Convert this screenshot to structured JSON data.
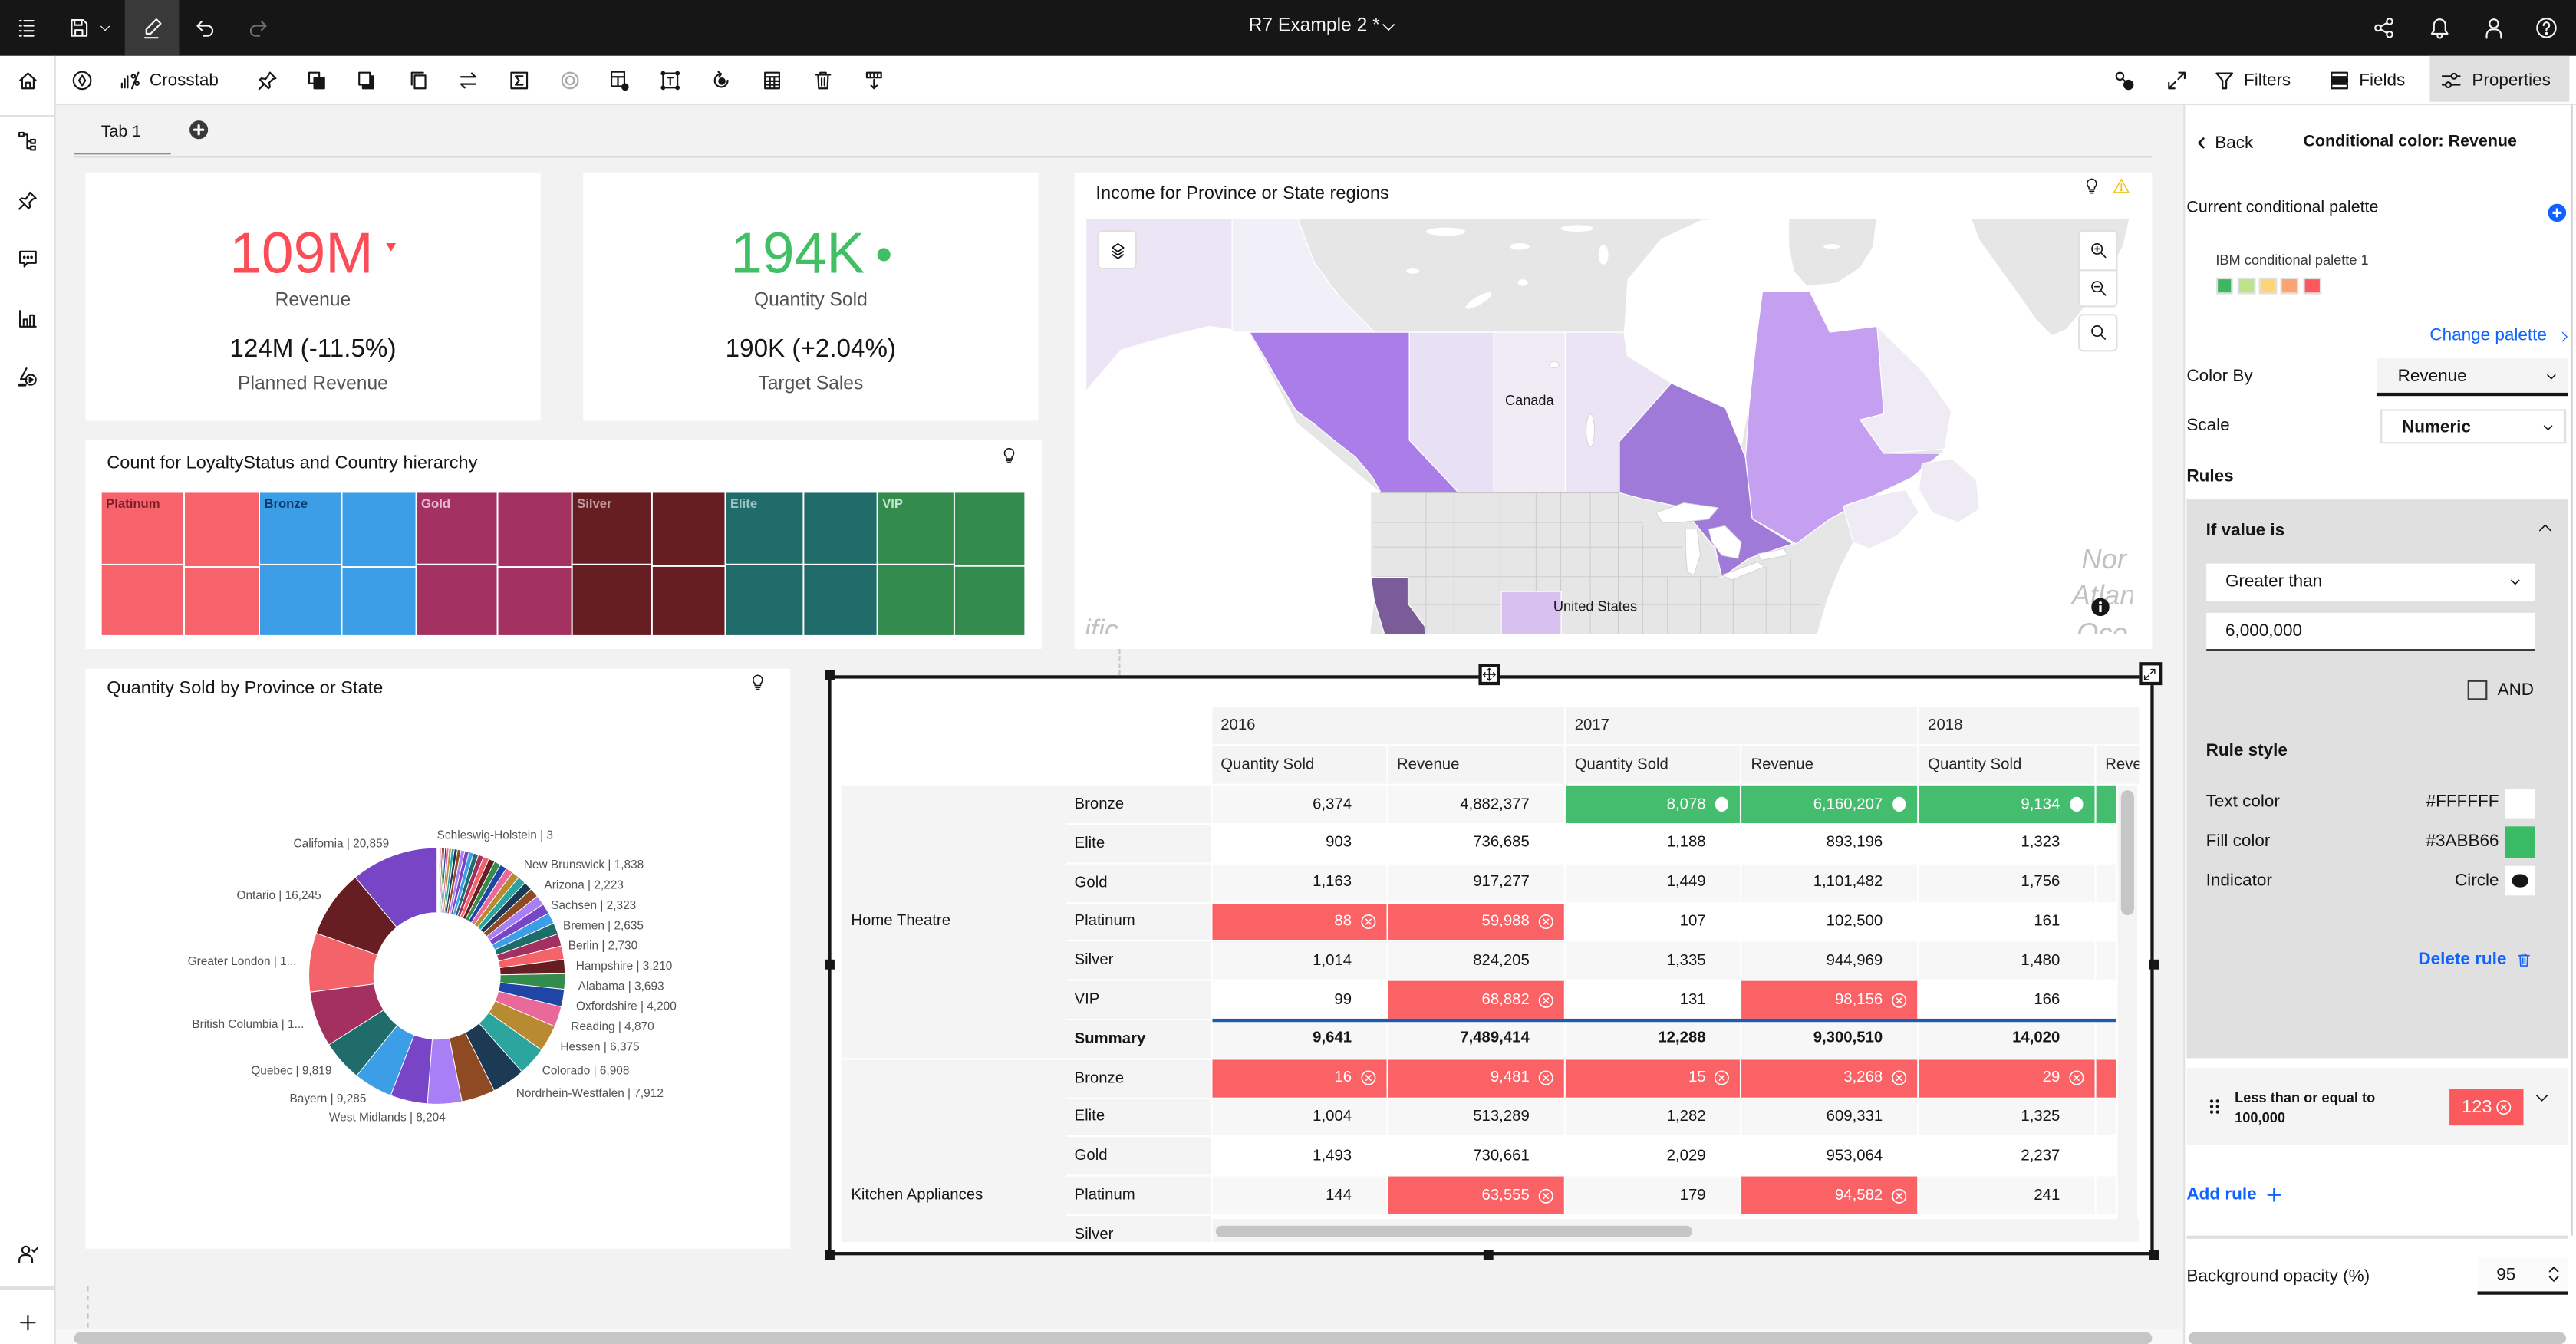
{
  "topbar": {
    "title": "R7 Example 2 *",
    "left_icons": [
      "menu-icon",
      "save-icon",
      "chevron-down-icon",
      "edit-icon",
      "undo-icon",
      "redo-icon"
    ],
    "right_icons": [
      "share-icon",
      "notification-icon",
      "user-icon",
      "help-icon"
    ]
  },
  "sidebar": {
    "items": [
      "home-icon",
      "data-tree-icon",
      "pin-icon",
      "chat-icon",
      "bar-chart-icon",
      "shapes-media-icon"
    ],
    "bottom_items": [
      "user-check-icon",
      "add-icon"
    ]
  },
  "toolbar": {
    "widget_type_label": "Crosstab",
    "icons": [
      "navigate-icon",
      "crosstab-icon",
      "pin-icon",
      "duplicate-icon",
      "bring-forward-icon",
      "send-backward-icon",
      "swap-icon",
      "summarize-icon",
      "format-icon",
      "table-settings-icon",
      "text-frame-icon",
      "refresh-icon",
      "table-icon",
      "delete-icon",
      "insert-column-icon"
    ],
    "right_icons": [
      "focus-icon",
      "expand-icon"
    ],
    "filters_label": "Filters",
    "fields_label": "Fields",
    "properties_label": "Properties",
    "active_panel": "Properties"
  },
  "tabs": [
    {
      "label": "Tab 1",
      "active": true
    }
  ],
  "kpis": [
    {
      "value": "109M",
      "label": "Revenue",
      "comparison": "124M (-11.5%)",
      "comparison_label": "Planned Revenue",
      "indicator": "down-triangle",
      "color": "#fa4d56"
    },
    {
      "value": "194K",
      "label": "Quantity Sold",
      "comparison": "190K (+2.04%)",
      "comparison_label": "Target Sales",
      "indicator": "circle",
      "color": "#42be65"
    }
  ],
  "map": {
    "title": "Income for Province or State regions",
    "country_labels": [
      "Canada",
      "United States"
    ],
    "ocean_label_fragments": [
      "Nor",
      "Atlan",
      "Oce",
      "ific"
    ],
    "water_color": "#ffffff",
    "land_color": "#e6e6e6",
    "fills": {
      "alaska": "#ebe5f6",
      "yukon": "#f1eff7",
      "british_columbia": "#ab7de8",
      "alberta": "#e8e0f5",
      "saskatchewan": "#efecf6",
      "manitoba": "#ebe4f5",
      "ontario": "#a07ad8",
      "quebec": "#c59ff0",
      "newfoundland_labrador": "#eeebf5",
      "maritimes": "#eeebf5",
      "california": "#7a5c98",
      "colorado": "#d9c1ef"
    }
  },
  "chart_data": [
    {
      "type": "pie",
      "variant": "donut",
      "title": "Quantity Sold by Province or State",
      "measure": "Quantity Sold",
      "order": "ascending, clockwise from top",
      "slices": [
        {
          "label": "Schleswig-Holstein",
          "value": 3,
          "text": "Schleswig-Holstein | 3",
          "color": "#b88b33"
        },
        {
          "value": 10,
          "color": "#2ba59e"
        },
        {
          "value": 25,
          "color": "#1c3a56"
        },
        {
          "value": 45,
          "color": "#8e4a22"
        },
        {
          "value": 70,
          "color": "#a87ff5"
        },
        {
          "value": 100,
          "color": "#7845c6"
        },
        {
          "value": 140,
          "color": "#3b9ee6"
        },
        {
          "value": 180,
          "color": "#1f6c6a"
        },
        {
          "value": 230,
          "color": "#a3305f"
        },
        {
          "value": 280,
          "color": "#f4626a"
        },
        {
          "value": 340,
          "color": "#661e22"
        },
        {
          "value": 400,
          "color": "#348b4e"
        },
        {
          "value": 460,
          "color": "#1f46a6"
        },
        {
          "value": 530,
          "color": "#e8699a"
        },
        {
          "value": 600,
          "color": "#b88b33"
        },
        {
          "value": 680,
          "color": "#2ba59e"
        },
        {
          "value": 760,
          "color": "#1c3a56"
        },
        {
          "value": 840,
          "color": "#8e4a22"
        },
        {
          "value": 930,
          "color": "#a87ff5"
        },
        {
          "value": 1020,
          "color": "#7845c6"
        },
        {
          "value": 1110,
          "color": "#3b9ee6"
        },
        {
          "value": 1200,
          "color": "#1f6c6a"
        },
        {
          "value": 1290,
          "color": "#a3305f"
        },
        {
          "value": 1380,
          "color": "#f4626a"
        },
        {
          "value": 1470,
          "color": "#661e22"
        },
        {
          "value": 1560,
          "color": "#348b4e"
        },
        {
          "value": 1650,
          "color": "#1f46a6"
        },
        {
          "value": 1740,
          "color": "#e8699a"
        },
        {
          "label": "New Brunswick",
          "value": 1838,
          "text": "New Brunswick | 1,838",
          "color": "#b88b33"
        },
        {
          "value": 1950,
          "color": "#2ba59e"
        },
        {
          "value": 2080,
          "color": "#1c3a56"
        },
        {
          "label": "Arizona",
          "value": 2223,
          "text": "Arizona | 2,223",
          "color": "#8e4a22"
        },
        {
          "label": "Sachsen",
          "value": 2323,
          "text": "Sachsen | 2,323",
          "color": "#a87ff5"
        },
        {
          "value": 2470,
          "color": "#7845c6"
        },
        {
          "label": "Bremen",
          "value": 2635,
          "text": "Bremen | 2,635",
          "color": "#3b9ee6"
        },
        {
          "label": "Berlin",
          "value": 2730,
          "text": "Berlin | 2,730",
          "color": "#1f6c6a"
        },
        {
          "value": 2950,
          "color": "#a3305f"
        },
        {
          "label": "Hampshire",
          "value": 3210,
          "text": "Hampshire | 3,210",
          "color": "#f4626a"
        },
        {
          "value": 3400,
          "color": "#661e22"
        },
        {
          "label": "Alabama",
          "value": 3693,
          "text": "Alabama | 3,693",
          "color": "#348b4e"
        },
        {
          "label": "Oxfordshire",
          "value": 4200,
          "text": "Oxfordshire | 4,200",
          "color": "#1f46a6"
        },
        {
          "label": "Reading",
          "value": 4870,
          "text": "Reading | 4,870",
          "color": "#e8699a"
        },
        {
          "label": "Hessen",
          "value": 6375,
          "text": "Hessen | 6,375",
          "color": "#b88b33"
        },
        {
          "label": "Colorado",
          "value": 6908,
          "text": "Colorado | 6,908",
          "color": "#2ba59e"
        },
        {
          "label": "Nordrhein-Westfalen",
          "value": 7912,
          "text": "Nordrhein-Westfalen | 7,912",
          "color": "#1c3a56"
        },
        {
          "value": 8050,
          "color": "#8e4a22"
        },
        {
          "label": "West Midlands",
          "value": 8204,
          "text": "West Midlands | 8,204",
          "color": "#a87ff5"
        },
        {
          "value": 8900,
          "color": "#7845c6"
        },
        {
          "label": "Bayern",
          "value": 9285,
          "text": "Bayern | 9,285",
          "color": "#3b9ee6"
        },
        {
          "label": "Quebec",
          "value": 9819,
          "text": "Quebec | 9,819",
          "color": "#1f6c6a"
        },
        {
          "label": "British Columbia",
          "value": 13300,
          "text": "British Columbia | 1...",
          "color": "#a3305f"
        },
        {
          "label": "Greater London",
          "value": 14100,
          "text": "Greater London | 1...",
          "color": "#f4626a"
        },
        {
          "label": "Ontario",
          "value": 16245,
          "text": "Ontario | 16,245",
          "color": "#661e22"
        },
        {
          "label": "California",
          "value": 20859,
          "text": "California | 20,859",
          "color": "#7845c6"
        }
      ]
    },
    {
      "type": "treemap",
      "title": "Count for LoyaltyStatus and Country hierarchy",
      "groups": [
        {
          "label": "Platinum",
          "color": "#f7636b",
          "label_color": "#7d1d2a",
          "values": [
            384,
            378,
            359,
            330
          ]
        },
        {
          "label": "Bronze",
          "color": "#3b9ee6",
          "label_color": "#0e3a6b",
          "values": [
            381,
            375,
            356,
            327
          ]
        },
        {
          "label": "Gold",
          "color": "#a33262",
          "label_color": "#e7bccd",
          "values": [
            375,
            370,
            356,
            327
          ]
        },
        {
          "label": "Silver",
          "color": "#661e23",
          "label_color": "#c39c9f",
          "values": [
            369,
            364,
            346,
            326
          ]
        },
        {
          "label": "Elite",
          "color": "#1f6c6b",
          "label_color": "#9cc3c1",
          "values": [
            361,
            356,
            341,
            336
          ]
        },
        {
          "label": "VIP",
          "color": "#348b4e",
          "label_color": "#c4e4cb",
          "values": [
            355,
            350,
            334,
            316
          ]
        }
      ]
    }
  ],
  "crosstab": {
    "years": [
      "2016",
      "2017",
      "2018"
    ],
    "measures": [
      "Quantity Sold",
      "Revenue",
      "Quantity Sold",
      "Revenue",
      "Quantity Sold",
      "Revenue"
    ],
    "rule_colors": {
      "high": "#3abb66",
      "low": "#fa5a5e"
    },
    "groups": [
      {
        "label": "Home Theatre",
        "rows": [
          {
            "label": "Bronze",
            "cells": [
              {
                "v": "6,374"
              },
              {
                "v": "4,882,377"
              },
              {
                "v": "8,078",
                "s": "high"
              },
              {
                "v": "6,160,207",
                "s": "high"
              },
              {
                "v": "9,134",
                "s": "high"
              },
              {
                "v": "",
                "s": "high"
              }
            ]
          },
          {
            "label": "Elite",
            "cells": [
              {
                "v": "903"
              },
              {
                "v": "736,685"
              },
              {
                "v": "1,188"
              },
              {
                "v": "893,196"
              },
              {
                "v": "1,323"
              },
              {
                "v": ""
              }
            ]
          },
          {
            "label": "Gold",
            "cells": [
              {
                "v": "1,163"
              },
              {
                "v": "917,277"
              },
              {
                "v": "1,449"
              },
              {
                "v": "1,101,482"
              },
              {
                "v": "1,756"
              },
              {
                "v": ""
              }
            ]
          },
          {
            "label": "Platinum",
            "cells": [
              {
                "v": "88",
                "s": "low"
              },
              {
                "v": "59,988",
                "s": "low"
              },
              {
                "v": "107"
              },
              {
                "v": "102,500"
              },
              {
                "v": "161"
              },
              {
                "v": ""
              }
            ]
          },
          {
            "label": "Silver",
            "cells": [
              {
                "v": "1,014"
              },
              {
                "v": "824,205"
              },
              {
                "v": "1,335"
              },
              {
                "v": "944,969"
              },
              {
                "v": "1,480"
              },
              {
                "v": ""
              }
            ]
          },
          {
            "label": "VIP",
            "cells": [
              {
                "v": "99"
              },
              {
                "v": "68,882",
                "s": "low"
              },
              {
                "v": "131"
              },
              {
                "v": "98,156",
                "s": "low"
              },
              {
                "v": "166"
              },
              {
                "v": ""
              }
            ]
          },
          {
            "label": "Summary",
            "summary": true,
            "cells": [
              {
                "v": "9,641"
              },
              {
                "v": "7,489,414"
              },
              {
                "v": "12,288"
              },
              {
                "v": "9,300,510"
              },
              {
                "v": "14,020"
              },
              {
                "v": ""
              }
            ]
          }
        ]
      },
      {
        "label": "Kitchen Appliances",
        "rows": [
          {
            "label": "Bronze",
            "cells": [
              {
                "v": "16",
                "s": "low"
              },
              {
                "v": "9,481",
                "s": "low"
              },
              {
                "v": "15",
                "s": "low"
              },
              {
                "v": "3,268",
                "s": "low"
              },
              {
                "v": "29",
                "s": "low"
              },
              {
                "v": "",
                "s": "low"
              }
            ]
          },
          {
            "label": "Elite",
            "cells": [
              {
                "v": "1,004"
              },
              {
                "v": "513,289"
              },
              {
                "v": "1,282"
              },
              {
                "v": "609,331"
              },
              {
                "v": "1,325"
              },
              {
                "v": ""
              }
            ]
          },
          {
            "label": "Gold",
            "cells": [
              {
                "v": "1,493"
              },
              {
                "v": "730,661"
              },
              {
                "v": "2,029"
              },
              {
                "v": "953,064"
              },
              {
                "v": "2,237"
              },
              {
                "v": ""
              }
            ]
          },
          {
            "label": "Platinum",
            "cells": [
              {
                "v": "144"
              },
              {
                "v": "63,555",
                "s": "low"
              },
              {
                "v": "179"
              },
              {
                "v": "94,582",
                "s": "low"
              },
              {
                "v": "241"
              },
              {
                "v": ""
              }
            ]
          },
          {
            "label": "Silver",
            "cells": []
          }
        ]
      }
    ]
  },
  "properties": {
    "back_label": "Back",
    "title": "Conditional color: Revenue",
    "palette_section_label": "Current conditional palette",
    "palette": {
      "name": "IBM conditional palette 1",
      "colors": [
        "#3db764",
        "#bde38b",
        "#fdd479",
        "#fba472",
        "#fa5a5e"
      ]
    },
    "change_palette_label": "Change palette",
    "color_by": {
      "label": "Color By",
      "value": "Revenue"
    },
    "scale": {
      "label": "Scale",
      "value": "Numeric"
    },
    "rules_label": "Rules",
    "rules": [
      {
        "expanded": true,
        "header": "If value is",
        "operator": "Greater than",
        "value": "6,000,000",
        "and_label": "AND",
        "and_checked": false,
        "style_label": "Rule style",
        "text_color": {
          "label": "Text color",
          "value": "#FFFFFF"
        },
        "fill_color": {
          "label": "Fill color",
          "value": "#3ABB66"
        },
        "indicator": {
          "label": "Indicator",
          "value": "Circle"
        },
        "delete_label": "Delete rule"
      },
      {
        "expanded": false,
        "summary_line1": "Less than or equal to",
        "summary_line2": "100,000",
        "preview_text": "123",
        "preview_fill": "#fa5a5e"
      }
    ],
    "add_rule_label": "Add rule",
    "background_opacity": {
      "label": "Background opacity (%)",
      "value": "95"
    }
  }
}
